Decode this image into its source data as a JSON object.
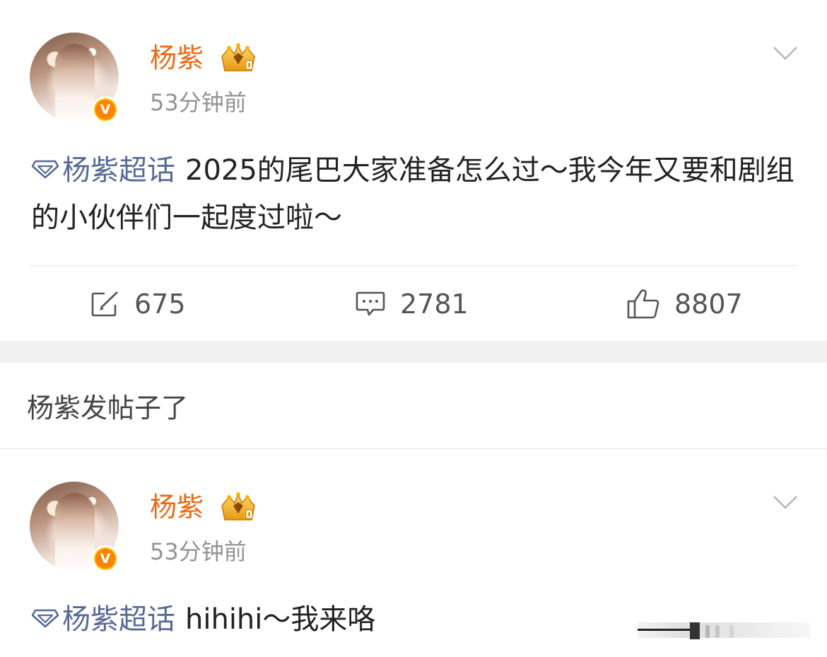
{
  "colors": {
    "username": "#e86b15",
    "topic": "#576b95",
    "verified_badge": "#ff8200",
    "text_primary": "#222222",
    "text_secondary": "#939393"
  },
  "posts": [
    {
      "author": "杨紫",
      "time": "53分钟前",
      "topic": "杨紫超话",
      "text": "2025的尾巴大家准备怎么过～我今年又要和剧组的小伙伴们一起度过啦～",
      "verified_badge": "V",
      "icons": [
        "avatar",
        "verified-badge-icon",
        "crown-member-icon",
        "chevron-down-icon",
        "supertopic-diamond-icon"
      ],
      "actions": {
        "repost": "675",
        "comment": "2781",
        "like": "8807"
      }
    },
    {
      "author": "杨紫",
      "time": "53分钟前",
      "topic": "杨紫超话",
      "text": "hihihi～我来咯",
      "verified_badge": "V"
    }
  ],
  "notice": "杨紫发帖子了",
  "action_icons": [
    "repost-icon",
    "comment-icon",
    "like-icon"
  ]
}
